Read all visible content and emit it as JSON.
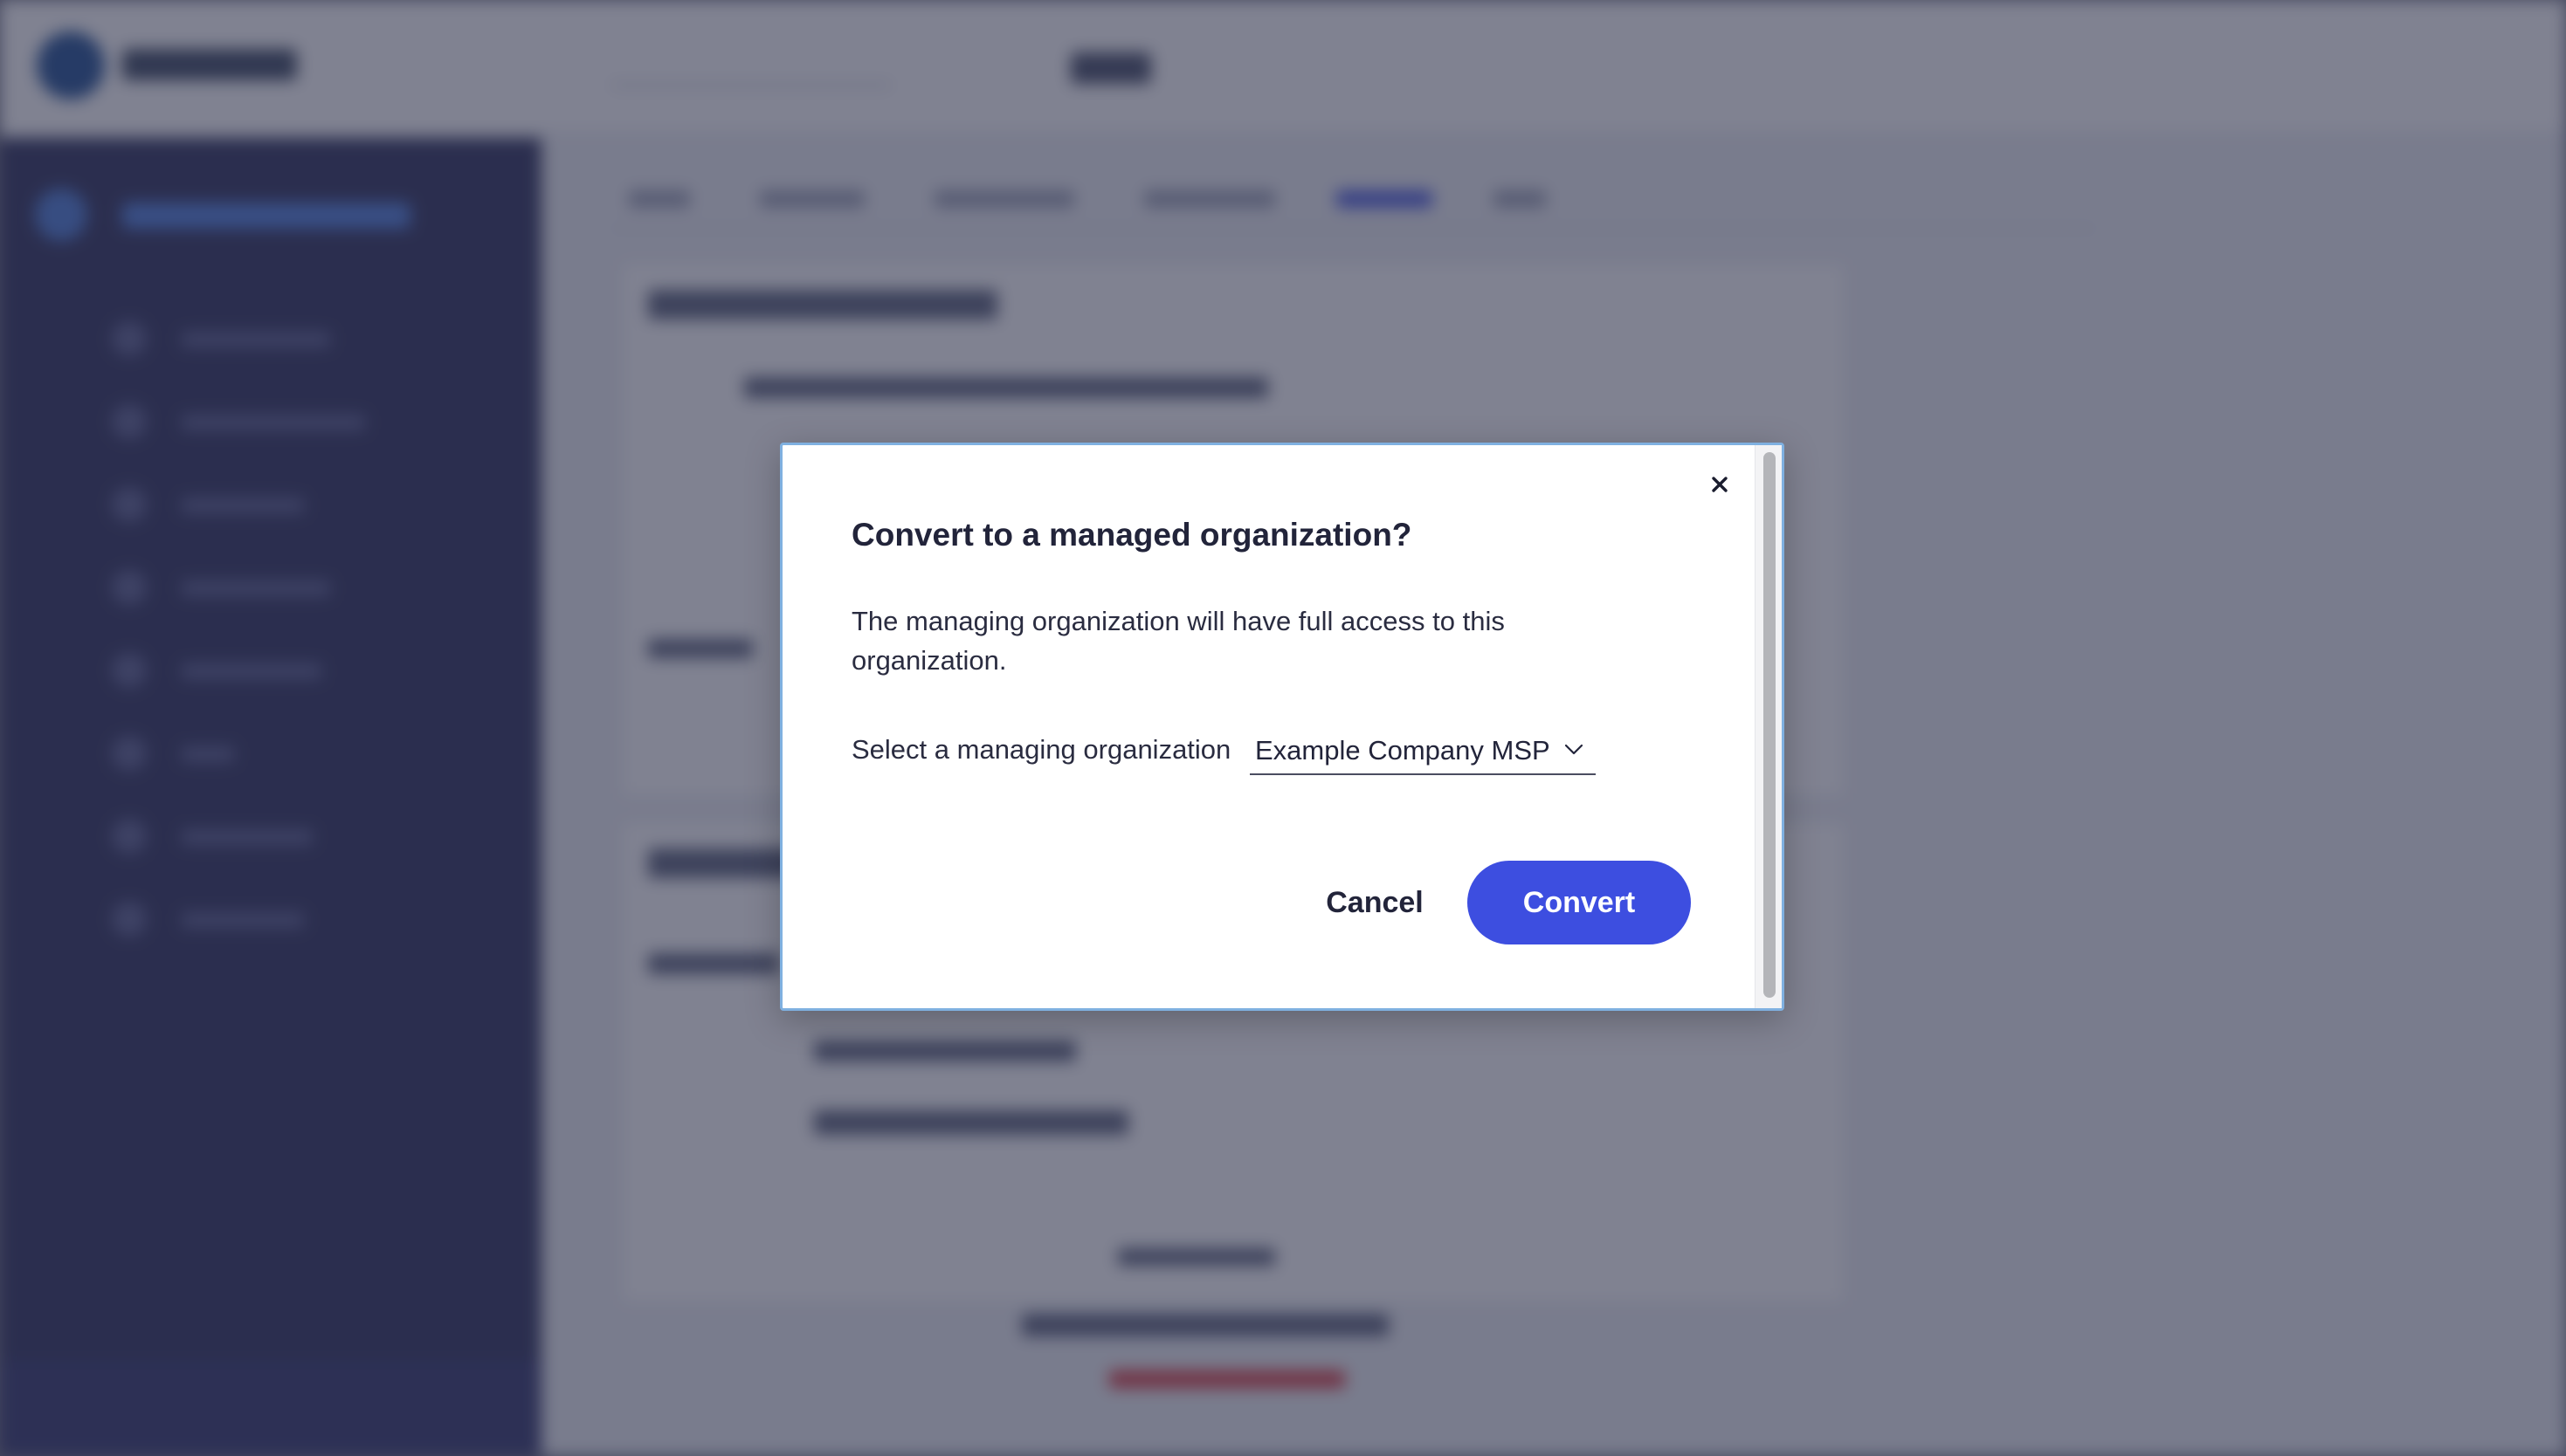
{
  "dialog": {
    "title": "Convert to a managed organization?",
    "description": "The managing organization will have full access to this organization.",
    "select_label": "Select a managing organization",
    "selected_organization": "Example Company MSP",
    "cancel_label": "Cancel",
    "convert_label": "Convert",
    "close_icon": "close-icon",
    "dropdown_icon": "chevron-down-icon"
  },
  "colors": {
    "primary": "#3d4ee0",
    "overlay": "#2c2e48",
    "sidebar": "#2c2f5a"
  }
}
